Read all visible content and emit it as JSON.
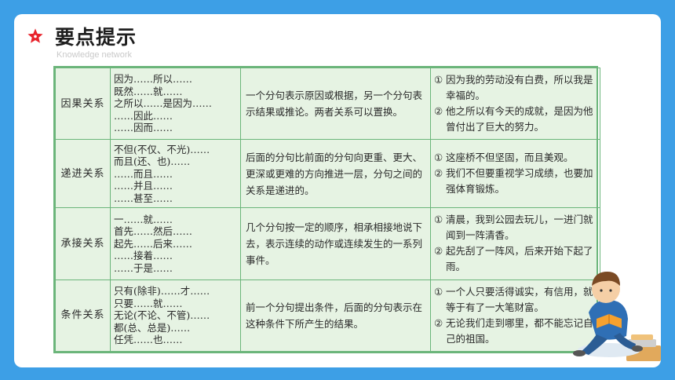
{
  "header": {
    "title": "要点提示",
    "subtitle": "Knowledge network",
    "accent_color": "#e8232c",
    "icon": "star-icon"
  },
  "rows": [
    {
      "type": "因果关系",
      "conjunctions": [
        "因为……所以……",
        "既然……就……",
        "之所以……是因为……",
        "……因此……",
        "……因而……"
      ],
      "description": "一个分句表示原因或根据，另一个分句表示结果或推论。两者关系可以置换。",
      "examples": [
        {
          "num": "①",
          "text": "因为我的劳动没有白费，所以我是幸福的。"
        },
        {
          "num": "②",
          "text": "他之所以有今天的成就，是因为他曾付出了巨大的努力。"
        }
      ]
    },
    {
      "type": "递进关系",
      "conjunctions": [
        "不但(不仅、不光)……",
        "而且(还、也)……",
        "……而且……",
        "……并且……",
        "……甚至……"
      ],
      "description": "后面的分句比前面的分句向更重、更大、更深或更难的方向推进一层，分句之间的关系是递进的。",
      "examples": [
        {
          "num": "①",
          "text": "这座桥不但坚固，而且美观。"
        },
        {
          "num": "②",
          "text": "我们不但要重视学习成绩，也要加强体育锻炼。"
        }
      ]
    },
    {
      "type": "承接关系",
      "conjunctions": [
        "一……就……",
        "首先……然后……",
        "起先……后来……",
        "……接着……",
        "……于是……"
      ],
      "description": "几个分句按一定的顺序，相承相接地说下去，表示连续的动作或连续发生的一系列事件。",
      "examples": [
        {
          "num": "①",
          "text": "清晨，我到公园去玩儿，一进门就闻到一阵清香。"
        },
        {
          "num": "②",
          "text": "起先刮了一阵风，后来开始下起了雨。"
        }
      ]
    },
    {
      "type": "条件关系",
      "conjunctions": [
        "只有(除非)……才……",
        "只要……就……",
        "无论(不论、不管)……",
        "都(总、总是)……",
        "任凭……也……"
      ],
      "description": "前一个分句提出条件，后面的分句表示在这种条件下所产生的结果。",
      "examples": [
        {
          "num": "①",
          "text": "一个人只要活得诚实，有信用，就等于有了一大笔财富。"
        },
        {
          "num": "②",
          "text": "无论我们走到哪里，都不能忘记自己的祖国。"
        }
      ]
    }
  ],
  "decoration": {
    "illustration": "boy-reading-icon",
    "frame_color": "#3d9fe6",
    "table_bg": "#e6f3e3",
    "table_border": "#6bb57a"
  }
}
